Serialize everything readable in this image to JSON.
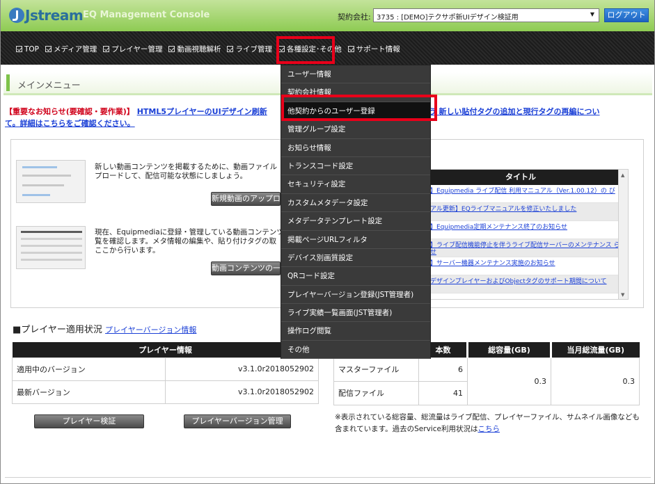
{
  "header": {
    "brand": "Jstream",
    "console_title": "EQ Management Console",
    "contract_label": "契約会社:",
    "contract_value": "3735 : [DEMO]テクサポ新UIデザイン検証用",
    "logout_label": "ログアウト"
  },
  "nav": {
    "items": [
      {
        "label": "TOP"
      },
      {
        "label": "メディア管理"
      },
      {
        "label": "プレイヤー管理"
      },
      {
        "label": "動画視聴解析"
      },
      {
        "label": "ライブ管理"
      },
      {
        "label": "各種設定･その他"
      },
      {
        "label": "サポート情報"
      }
    ]
  },
  "dropdown": {
    "items": [
      {
        "label": "ユーザー情報"
      },
      {
        "label": "契約会社情報"
      },
      {
        "label": "他契約からのユーザー登録"
      },
      {
        "label": "管理グループ設定"
      },
      {
        "label": "お知らせ情報"
      },
      {
        "label": "トランスコード設定"
      },
      {
        "label": "セキュリティ設定"
      },
      {
        "label": "カスタムメタデータ設定"
      },
      {
        "label": "メタデータテンプレート設定"
      },
      {
        "label": "掲載ページURLフィルタ"
      },
      {
        "label": "デバイス別画質設定"
      },
      {
        "label": "QRコード設定"
      },
      {
        "label": "プレイヤーバージョン登録(JST管理者)"
      },
      {
        "label": "ライブ実績一覧画面(JST管理者)"
      },
      {
        "label": "操作ログ閲覧"
      },
      {
        "label": "その他"
      }
    ]
  },
  "main": {
    "menu_title": "メインメニュー",
    "notice_red": "【重要なお知らせ(要確認・要作業)】",
    "notice_link_1": "HTML5プレイヤーのUIデザイン刷新",
    "notice_link_2": "に伴う 新しい貼付タグの追加と現行タグの再編につい",
    "notice_link_3": "て。詳細はこちらをご確認ください。",
    "upload_desc_1": "新しい動画コンテンツを掲載するために、動画ファイル",
    "upload_desc_2": "プロードして、配信可能な状態にしましょう。",
    "upload_button": "新規動画のアップロ",
    "manage_desc_1": "現在、Equipmediaに登録・管理している動画コンテンツ",
    "manage_desc_2": "覧を確認します。メタ情報の編集や、貼り付けタグの取",
    "manage_desc_3": "ここから行います。",
    "manage_button": "動画コンテンツの一",
    "news_header": "タイトル",
    "news": [
      {
        "text": "】Equipmedia ライブ配信 利用マニュアル（Ver.1.00.12）の び"
      },
      {
        "text": "アル更新】EQライブマニュアルを修正いたしました"
      },
      {
        "text": "】Equipmedia定期メンテナンス終了のお知らせ"
      },
      {
        "text": "】ライブ配信機能停止を伴うライブ配信サーバーのメンテナンス らせ"
      },
      {
        "text": "】サーバー機器メンテナンス実施のお知らせ"
      },
      {
        "text": "デザインプレイヤーおよびObjectタグのサポート期間について"
      }
    ]
  },
  "player": {
    "title": "■プレイヤー適用状況",
    "title_link": "プレイヤーバージョン情報",
    "table_header": "プレイヤー情報",
    "rows": [
      {
        "label": "適用中のバージョン",
        "value": "v3.1.0r2018052902"
      },
      {
        "label": "最新バージョン",
        "value": "v3.1.0r2018052902"
      }
    ],
    "verify_button": "プレイヤー検証",
    "version_button": "プレイヤーバージョン管理"
  },
  "storage": {
    "col_count": "本数",
    "col_capacity": "総容量(GB)",
    "col_traffic": "当月総流量(GB)",
    "master_label": "マスターファイル",
    "master_count": "6",
    "delivery_label": "配信ファイル",
    "delivery_count": "41",
    "capacity_value": "0.3",
    "traffic_value": "0.3",
    "note": "※表示されている総容量、総流量はライブ配信、プレイヤーファイル、サムネイル画像なども含まれています。過去のService利用状況は",
    "note_link": "こちら"
  },
  "colors": {
    "header_green": "#8ecb53",
    "highlight_red": "#e8001a",
    "link_blue": "#1a3fd6",
    "notice_red": "#d0021b"
  }
}
